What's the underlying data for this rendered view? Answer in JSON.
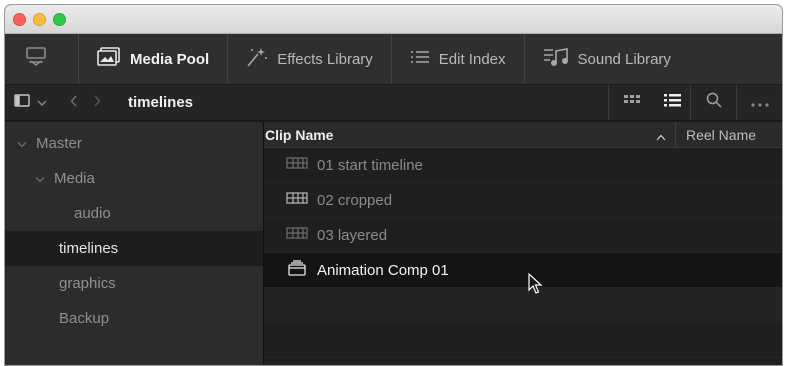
{
  "modules": [
    {
      "label": "",
      "icon": "monitor-icon"
    },
    {
      "label": "Media Pool",
      "icon": "media-pool-icon",
      "active": true
    },
    {
      "label": "Effects Library",
      "icon": "magic-wand-icon"
    },
    {
      "label": "Edit Index",
      "icon": "list-icon"
    },
    {
      "label": "Sound Library",
      "icon": "music-note-icon"
    }
  ],
  "subbar": {
    "current_bin": "timelines"
  },
  "bins": [
    {
      "label": "Master",
      "expanded": true
    },
    {
      "label": "Media",
      "expanded": true
    },
    {
      "label": "audio"
    },
    {
      "label": "timelines",
      "selected": true
    },
    {
      "label": "graphics"
    },
    {
      "label": "Backup"
    }
  ],
  "columns": {
    "clip_name": "Clip Name",
    "reel_name": "Reel Name"
  },
  "clips": [
    {
      "name": "01 start timeline",
      "icon": "timeline-icon"
    },
    {
      "name": "02 cropped",
      "icon": "timeline-icon"
    },
    {
      "name": "03 layered",
      "icon": "timeline-icon"
    },
    {
      "name": "Animation Comp 01",
      "icon": "fusion-comp-icon",
      "selected": true
    }
  ],
  "colors": {
    "panel_bg": "#1f1f21",
    "toolbar_bg": "#2f2f31",
    "sidebar_bg": "#2c2c2e",
    "selected_bg": "#141416"
  }
}
